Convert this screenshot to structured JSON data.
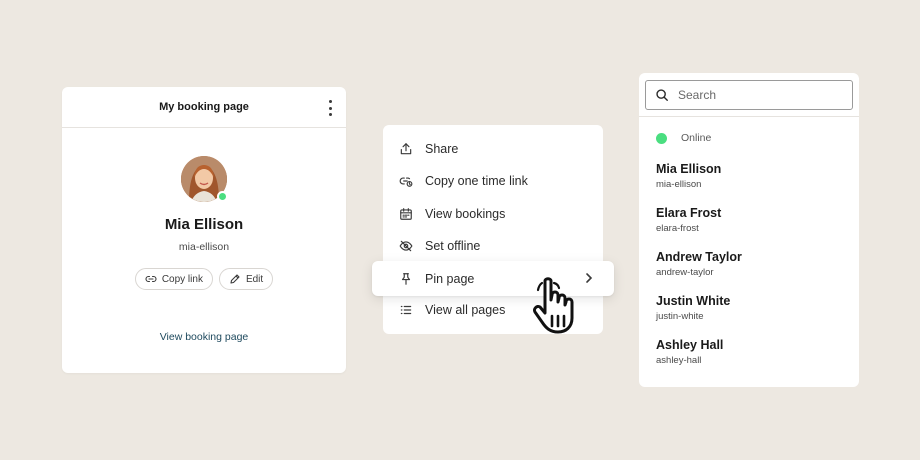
{
  "booking_card": {
    "title": "My booking page",
    "name": "Mia Ellison",
    "handle": "mia-ellison",
    "copy_link_label": "Copy link",
    "edit_label": "Edit",
    "view_link_label": "View booking page",
    "status_color": "#4ade80"
  },
  "menu": {
    "items": [
      {
        "label": "Share",
        "icon": "share-icon"
      },
      {
        "label": "Copy one time link",
        "icon": "link-clock-icon"
      },
      {
        "label": "View bookings",
        "icon": "calendar-icon"
      },
      {
        "label": "Set offline",
        "icon": "eye-off-icon"
      },
      {
        "label": "Pin page",
        "icon": "pin-icon",
        "active": true,
        "has_submenu": true
      },
      {
        "label": "View all pages",
        "icon": "list-icon"
      }
    ]
  },
  "members": {
    "search_placeholder": "Search",
    "online_label": "Online",
    "online_color": "#4ade80",
    "list": [
      {
        "name": "Mia Ellison",
        "handle": "mia-ellison"
      },
      {
        "name": "Elara Frost",
        "handle": "elara-frost"
      },
      {
        "name": "Andrew Taylor",
        "handle": "andrew-taylor"
      },
      {
        "name": "Justin White",
        "handle": "justin-white"
      },
      {
        "name": "Ashley Hall",
        "handle": "ashley-hall"
      }
    ]
  },
  "colors": {
    "background": "#ede8e1",
    "link": "#1f4a5e",
    "online": "#4ade80"
  }
}
